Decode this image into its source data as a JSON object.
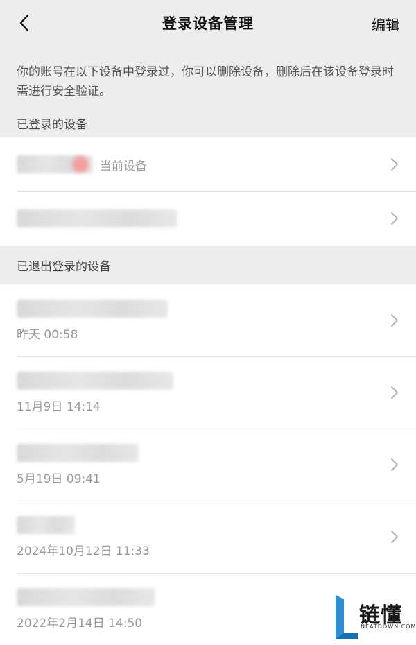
{
  "nav": {
    "title": "登录设备管理",
    "edit_label": "编辑",
    "back_icon": "chevron-left-icon"
  },
  "description": "你的账号在以下设备中登录过，你可以删除设备，删除后在该设备登录时需进行安全验证。",
  "logged_in": {
    "header": "已登录的设备",
    "current_label": "当前设备"
  },
  "logged_out": {
    "header": "已退出登录的设备",
    "times": [
      "昨天 00:58",
      "11月9日 14:14",
      "5月19日 09:41",
      "2024年10月12日 11:33",
      "2022年2月14日 14:50"
    ]
  },
  "watermark": {
    "text": "链懂",
    "sub": "NEATDOWN.COM"
  }
}
